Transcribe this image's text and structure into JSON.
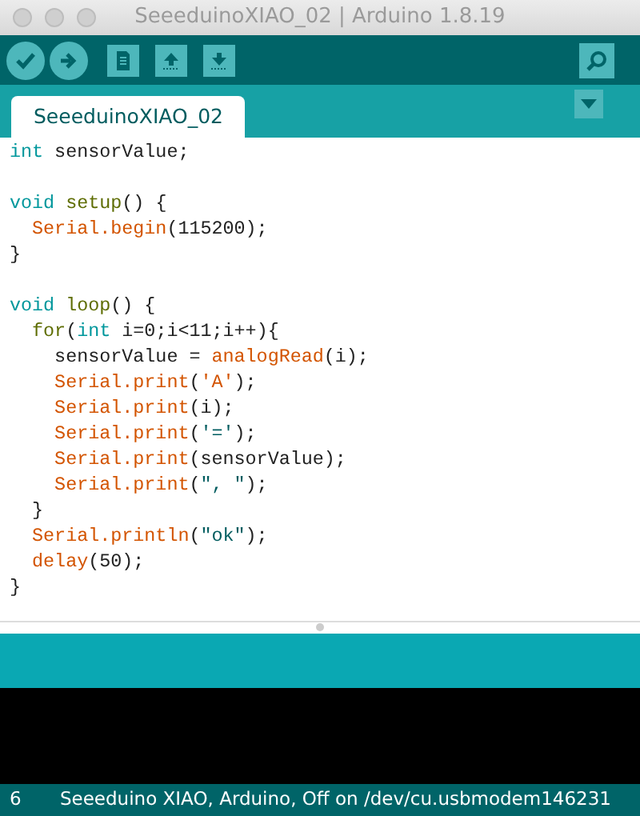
{
  "window": {
    "title": "SeeeduinoXIAO_02 | Arduino 1.8.19"
  },
  "tabs": [
    {
      "label": "SeeeduinoXIAO_02",
      "selected": true
    }
  ],
  "editor": {
    "lines": [
      {
        "kind": "code",
        "tokens": [
          {
            "text": "int",
            "kind": "type"
          },
          {
            "text": " sensorValue;",
            "kind": "plain"
          }
        ]
      },
      {
        "kind": "blank"
      },
      {
        "kind": "code",
        "tokens": [
          {
            "text": "void",
            "kind": "type"
          },
          {
            "text": " setup",
            "kind": "control"
          },
          {
            "text": "() {",
            "kind": "plain"
          }
        ]
      },
      {
        "kind": "code",
        "tokens": [
          {
            "text": "  Serial.begin",
            "kind": "func"
          },
          {
            "text": "(115200);",
            "kind": "plain"
          }
        ]
      },
      {
        "kind": "code",
        "tokens": [
          {
            "text": "}",
            "kind": "plain"
          }
        ]
      },
      {
        "kind": "blank"
      },
      {
        "kind": "code",
        "tokens": [
          {
            "text": "void",
            "kind": "type"
          },
          {
            "text": " loop",
            "kind": "control"
          },
          {
            "text": "() {",
            "kind": "plain"
          }
        ]
      },
      {
        "kind": "code",
        "tokens": [
          {
            "text": "  for",
            "kind": "control"
          },
          {
            "text": "(",
            "kind": "plain"
          },
          {
            "text": "int",
            "kind": "type"
          },
          {
            "text": " i=0;i<11;i++){",
            "kind": "plain"
          }
        ]
      },
      {
        "kind": "code",
        "tokens": [
          {
            "text": "    sensorValue = ",
            "kind": "plain"
          },
          {
            "text": "analogRead",
            "kind": "func"
          },
          {
            "text": "(i);",
            "kind": "plain"
          }
        ]
      },
      {
        "kind": "code",
        "tokens": [
          {
            "text": "    Serial.print",
            "kind": "func"
          },
          {
            "text": "(",
            "kind": "plain"
          },
          {
            "text": "'A'",
            "kind": "func"
          },
          {
            "text": ");",
            "kind": "plain"
          }
        ]
      },
      {
        "kind": "code",
        "tokens": [
          {
            "text": "    Serial.print",
            "kind": "func"
          },
          {
            "text": "(i);",
            "kind": "plain"
          }
        ]
      },
      {
        "kind": "code",
        "tokens": [
          {
            "text": "    Serial.print",
            "kind": "func"
          },
          {
            "text": "(",
            "kind": "plain"
          },
          {
            "text": "'='",
            "kind": "string"
          },
          {
            "text": ");",
            "kind": "plain"
          }
        ]
      },
      {
        "kind": "code",
        "tokens": [
          {
            "text": "    Serial.print",
            "kind": "func"
          },
          {
            "text": "(sensorValue);",
            "kind": "plain"
          }
        ]
      },
      {
        "kind": "code",
        "tokens": [
          {
            "text": "    Serial.print",
            "kind": "func"
          },
          {
            "text": "(",
            "kind": "plain"
          },
          {
            "text": "\", \"",
            "kind": "string"
          },
          {
            "text": ");",
            "kind": "plain"
          }
        ]
      },
      {
        "kind": "code",
        "tokens": [
          {
            "text": "  }",
            "kind": "plain"
          }
        ]
      },
      {
        "kind": "code",
        "tokens": [
          {
            "text": "  Serial.println",
            "kind": "func"
          },
          {
            "text": "(",
            "kind": "plain"
          },
          {
            "text": "\"ok\"",
            "kind": "string"
          },
          {
            "text": ");",
            "kind": "plain"
          }
        ]
      },
      {
        "kind": "code",
        "tokens": [
          {
            "text": "  delay",
            "kind": "func"
          },
          {
            "text": "(50);",
            "kind": "plain"
          }
        ]
      },
      {
        "kind": "code",
        "tokens": [
          {
            "text": "}",
            "kind": "plain"
          }
        ]
      }
    ]
  },
  "status_bar": {
    "line": "6",
    "board": "Seeeduino XIAO, Arduino, Off on /dev/cu.usbmodem146231"
  }
}
